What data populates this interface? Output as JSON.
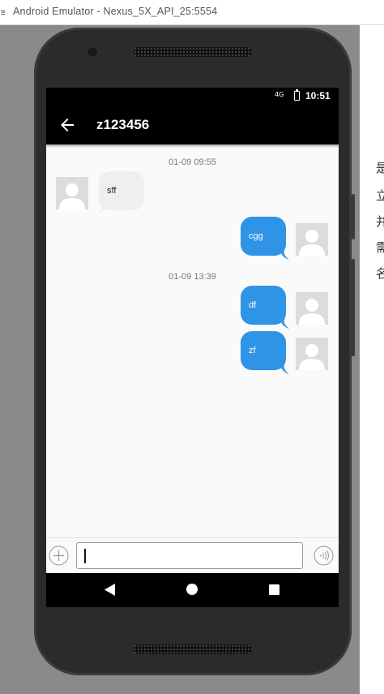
{
  "window": {
    "title": "Android Emulator - Nexus_5X_API_25:5554"
  },
  "side_text": [
    "是",
    "立",
    "并",
    "需",
    "名"
  ],
  "status_bar": {
    "signal": "4G",
    "time": "10:51"
  },
  "toolbar": {
    "title": "z123456"
  },
  "chat": {
    "timestamps": [
      "01-09 09:55",
      "01-09 13:39"
    ],
    "messages": [
      {
        "direction": "incoming",
        "text": "sff"
      },
      {
        "direction": "outgoing",
        "text": "cgg"
      },
      {
        "direction": "outgoing",
        "text": "df"
      },
      {
        "direction": "outgoing",
        "text": "zf"
      }
    ]
  },
  "input": {
    "value": "",
    "placeholder": ""
  },
  "colors": {
    "outgoing_bubble": "#2f93e6",
    "incoming_bubble": "#efeff1",
    "toolbar": "#000000"
  },
  "icons": [
    "back-arrow-icon",
    "plus-icon",
    "voice-icon",
    "nav-back-icon",
    "nav-home-icon",
    "nav-recent-icon"
  ]
}
